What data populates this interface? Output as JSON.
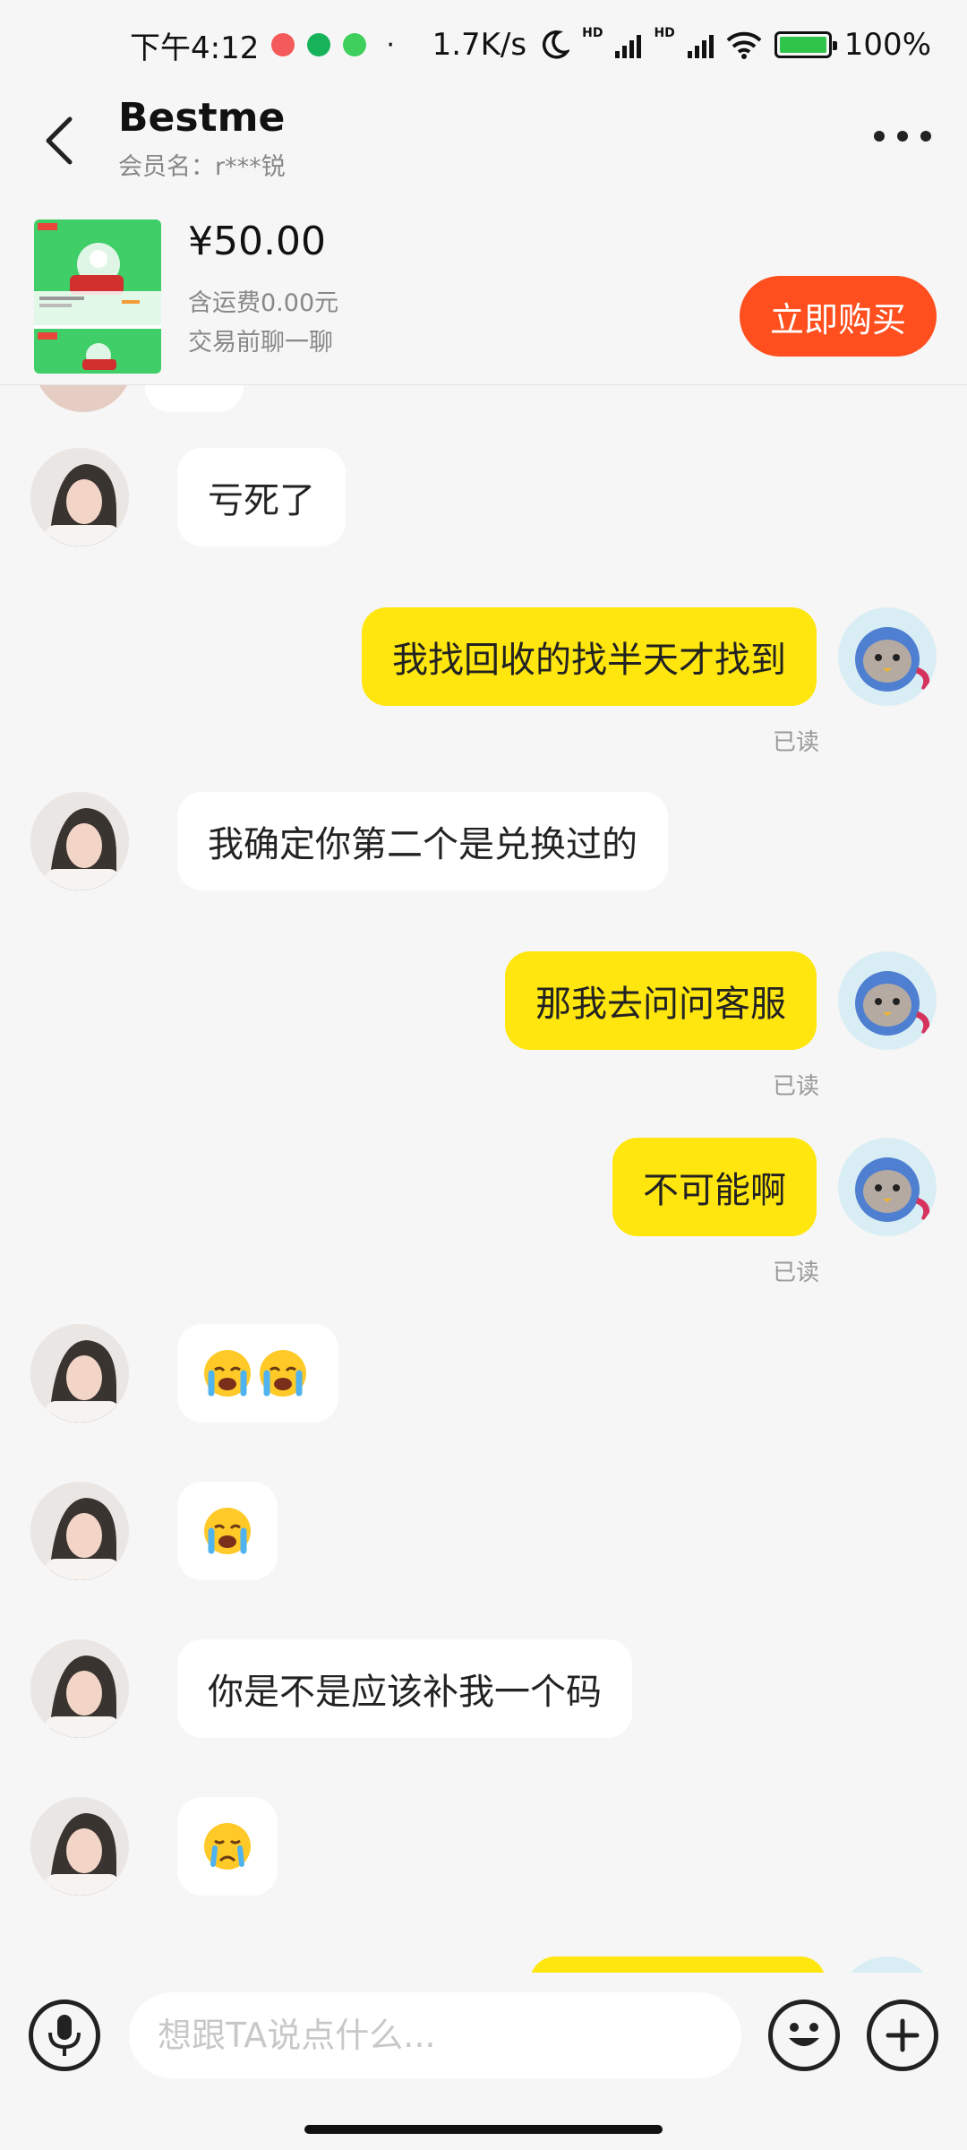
{
  "status_bar": {
    "time": "下午4:12",
    "network_speed": "1.7K/s",
    "hd": "HD",
    "battery": "100%",
    "battery_level": 1.0
  },
  "header": {
    "title": "Bestme",
    "member": "会员名：r***锐"
  },
  "product": {
    "price": "¥50.00",
    "shipping": "含运费0.00元",
    "note": "交易前聊一聊",
    "buy_label": "立即购买"
  },
  "colors": {
    "self_bubble": "#ffe60f",
    "buy_button": "#ff4f1f",
    "background": "#f6f6f6"
  },
  "messages": [
    {
      "side": "in",
      "text": "亏死了"
    },
    {
      "side": "out",
      "text": "我找回收的找半天才找到",
      "status": "已读"
    },
    {
      "side": "in",
      "text": "我确定你第二个是兑换过的"
    },
    {
      "side": "out",
      "text": "那我去问问客服",
      "status": "已读"
    },
    {
      "side": "out",
      "text": "不可能啊",
      "status": "已读"
    },
    {
      "side": "in",
      "emoji": [
        "loudly-crying-face",
        "loudly-crying-face"
      ]
    },
    {
      "side": "in",
      "emoji": [
        "loudly-crying-face"
      ]
    },
    {
      "side": "in",
      "text": "你是不是应该补我一个码"
    },
    {
      "side": "in",
      "emoji": [
        "crying-face"
      ]
    }
  ],
  "input": {
    "placeholder": "想跟TA说点什么..."
  }
}
